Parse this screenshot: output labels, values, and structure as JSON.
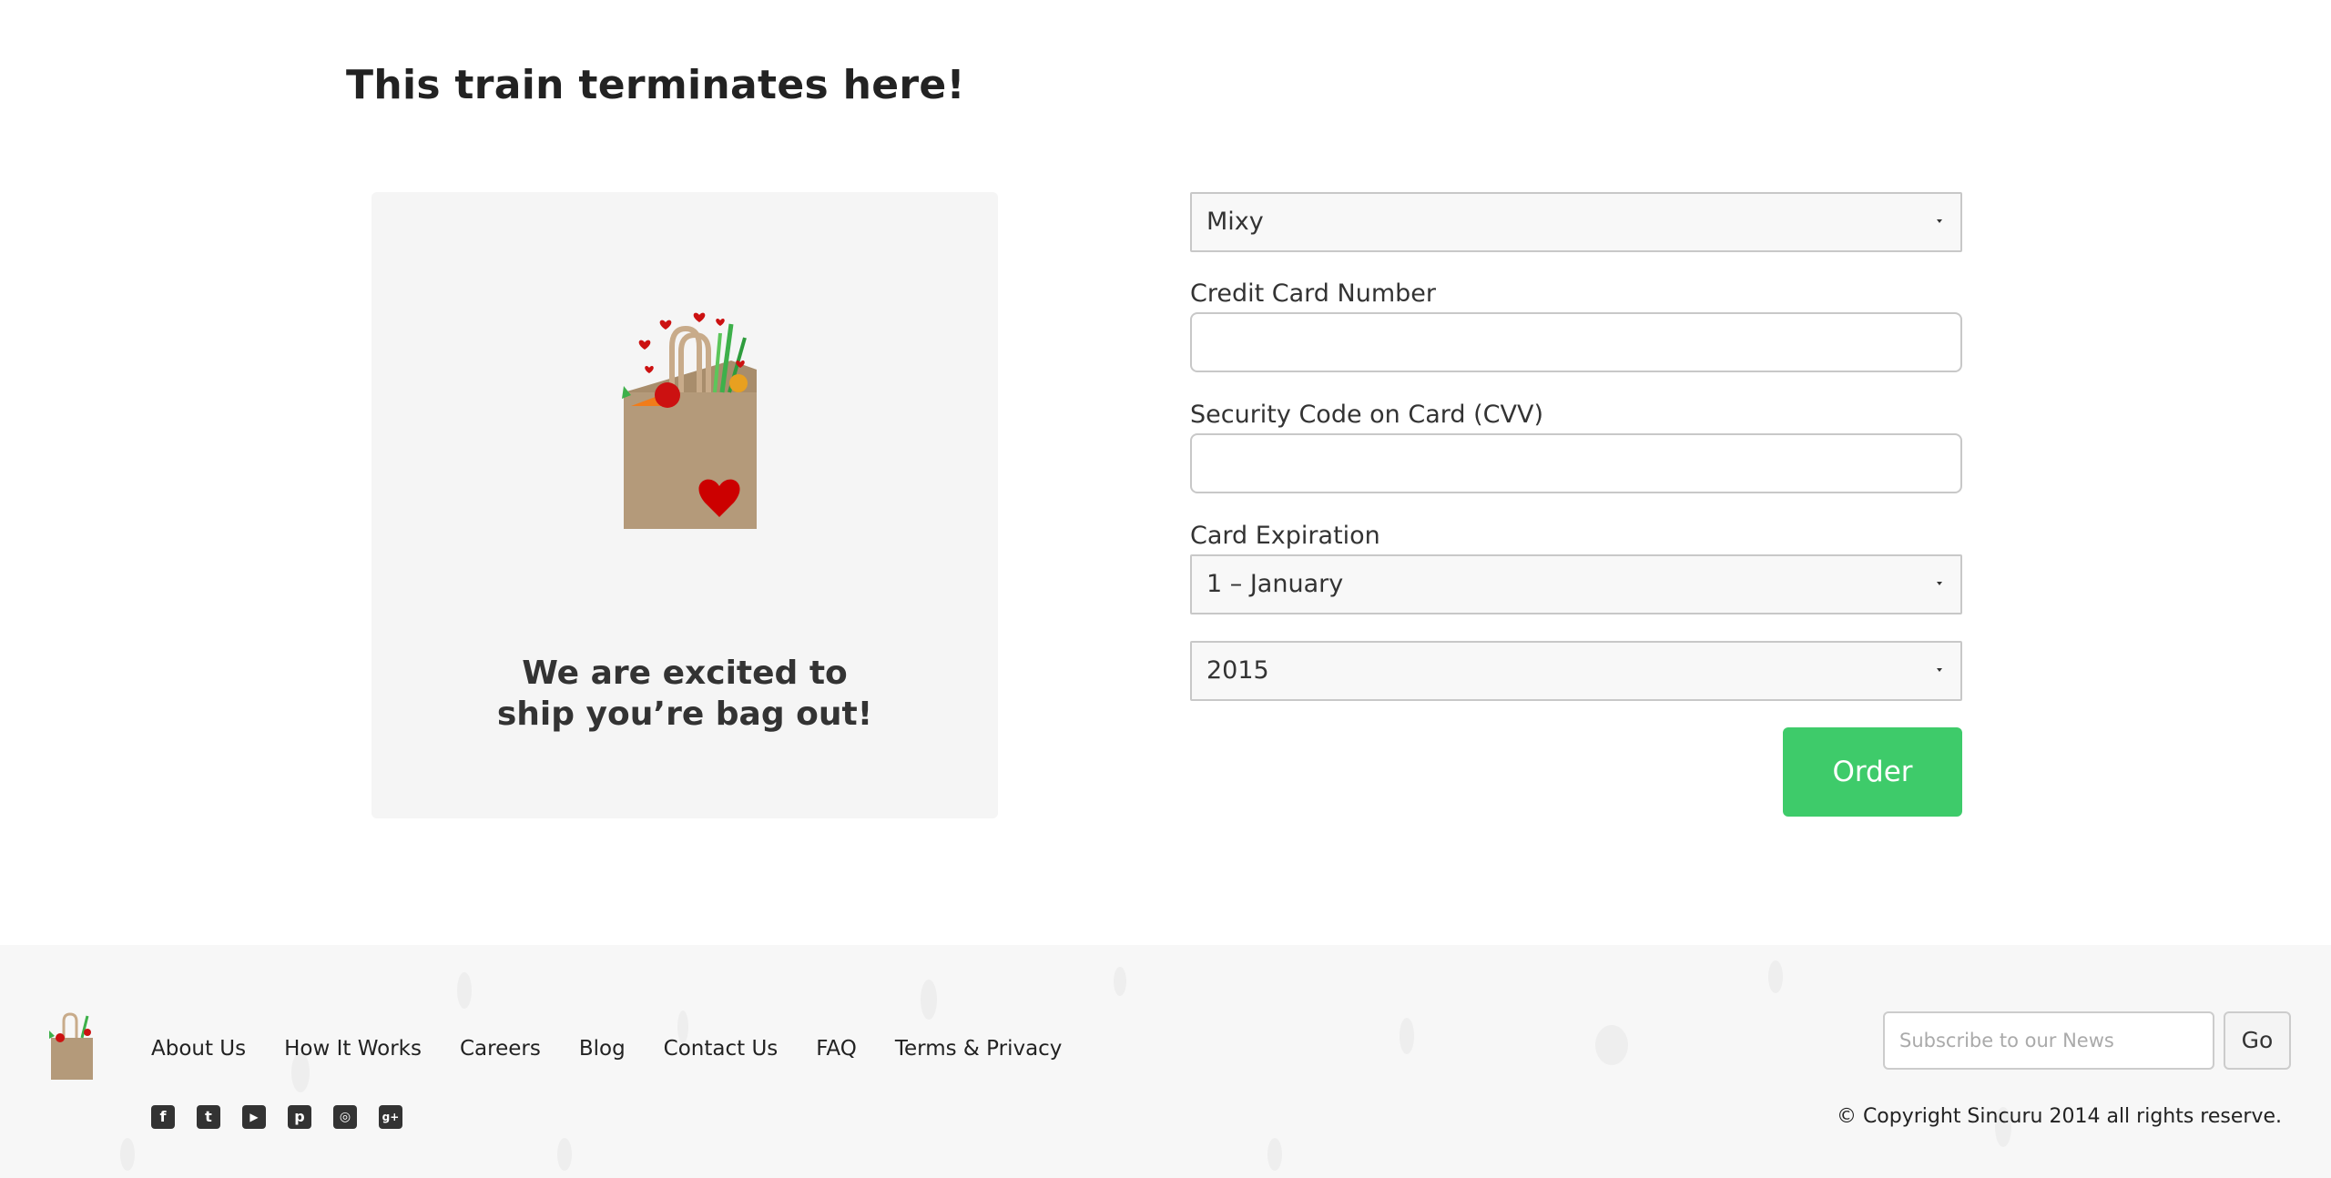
{
  "page": {
    "title": "This train terminates here!"
  },
  "promo": {
    "line1": "We are excited to",
    "line2": "ship you’re bag out!"
  },
  "form": {
    "plan_select": {
      "value": "Mixy"
    },
    "card_number": {
      "label": "Credit Card Number",
      "value": ""
    },
    "cvv": {
      "label": "Security Code on Card (CVV)",
      "value": ""
    },
    "expiration": {
      "label": "Card Expiration",
      "month_value": "1 – January",
      "year_value": "2015"
    },
    "order_label": "Order"
  },
  "footer": {
    "nav": [
      "About Us",
      "How It Works",
      "Careers",
      "Blog",
      "Contact Us",
      "FAQ",
      "Terms & Privacy"
    ],
    "social": [
      {
        "name": "facebook-icon",
        "glyph": "f"
      },
      {
        "name": "twitter-icon",
        "glyph": "t"
      },
      {
        "name": "youtube-icon",
        "glyph": "▶"
      },
      {
        "name": "pinterest-icon",
        "glyph": "p"
      },
      {
        "name": "instagram-icon",
        "glyph": "◎"
      },
      {
        "name": "google-plus-icon",
        "glyph": "g+"
      }
    ],
    "subscribe": {
      "placeholder": "Subscribe to our News",
      "button_label": "Go"
    },
    "copyright": "© Copyright Sincuru 2014 all rights reserve."
  },
  "colors": {
    "accent": "#3ecb6a",
    "bag": "#b49a7a",
    "heart": "#cc0000"
  }
}
